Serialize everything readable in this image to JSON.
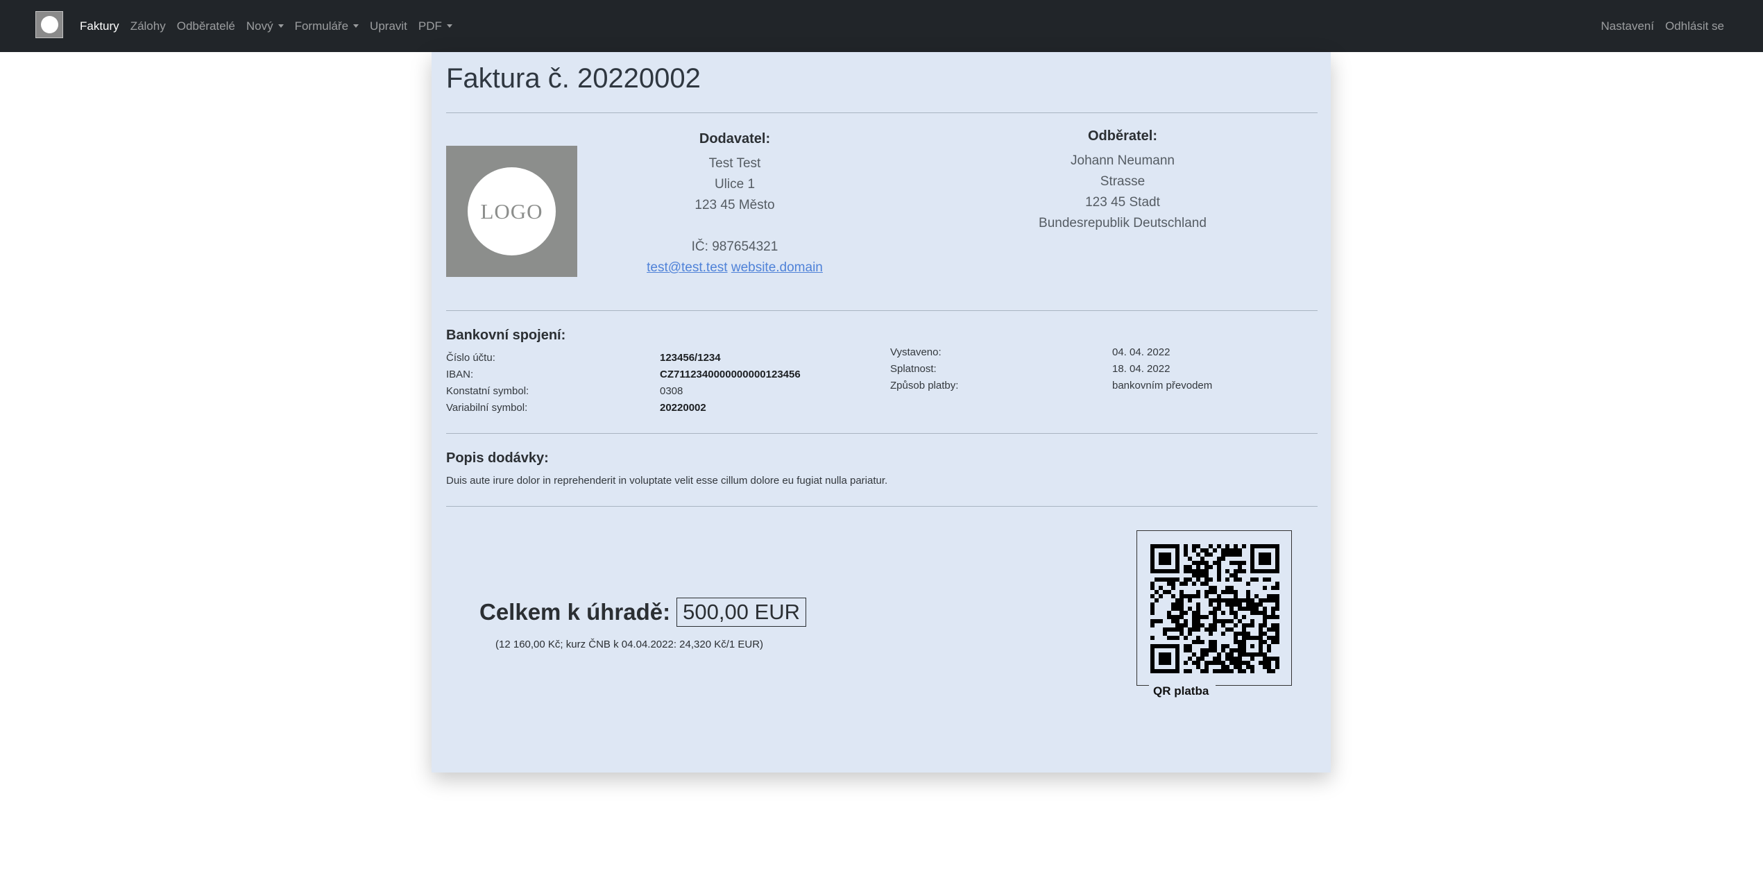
{
  "navbar": {
    "left_items": [
      {
        "label": "Faktury",
        "active": true,
        "dropdown": false
      },
      {
        "label": "Zálohy",
        "active": false,
        "dropdown": false
      },
      {
        "label": "Odběratelé",
        "active": false,
        "dropdown": false
      },
      {
        "label": "Nový",
        "active": false,
        "dropdown": true
      },
      {
        "label": "Formuláře",
        "active": false,
        "dropdown": true
      },
      {
        "label": "Upravit",
        "active": false,
        "dropdown": false
      },
      {
        "label": "PDF",
        "active": false,
        "dropdown": true
      }
    ],
    "right_items": [
      {
        "label": "Nastavení"
      },
      {
        "label": "Odhlásit se"
      }
    ]
  },
  "invoice": {
    "title": "Faktura č. 20220002",
    "logo_text": "LOGO",
    "supplier": {
      "heading": "Dodavatel:",
      "name": "Test Test",
      "street": "Ulice 1",
      "city": "123 45 Město",
      "ico": "IČ: 987654321",
      "email": "test@test.test",
      "website": "website.domain"
    },
    "customer": {
      "heading": "Odběratel:",
      "name": "Johann Neumann",
      "street": "Strasse",
      "city": "123 45 Stadt",
      "country": "Bundesrepublik Deutschland"
    },
    "bank": {
      "heading": "Bankovní spojení:",
      "account_label": "Číslo účtu:",
      "account_value": "123456/1234",
      "iban_label": "IBAN:",
      "iban_value": "CZ7112340000000000123456",
      "ks_label": "Konstatní symbol:",
      "ks_value": "0308",
      "vs_label": "Variabilní symbol:",
      "vs_value": "20220002"
    },
    "dates": {
      "issued_label": "Vystaveno:",
      "issued_value": "04. 04. 2022",
      "due_label": "Splatnost:",
      "due_value": "18. 04. 2022",
      "payment_label": "Způsob platby:",
      "payment_value": "bankovním převodem"
    },
    "delivery": {
      "heading": "Popis dodávky:",
      "text": "Duis aute irure dolor in reprehenderit in voluptate velit esse cillum dolore eu fugiat nulla pariatur."
    },
    "total": {
      "label": "Celkem k úhradě:",
      "amount": "500,00 EUR",
      "conversion": "(12 160,00 Kč; kurz ČNB k 04.04.2022: 24,320 Kč/1 EUR)"
    },
    "qr": {
      "label": "QR platba"
    }
  },
  "colors": {
    "navbar_bg": "#212529",
    "sheet_bg": "#dee7f4",
    "link": "#4f82d8"
  }
}
